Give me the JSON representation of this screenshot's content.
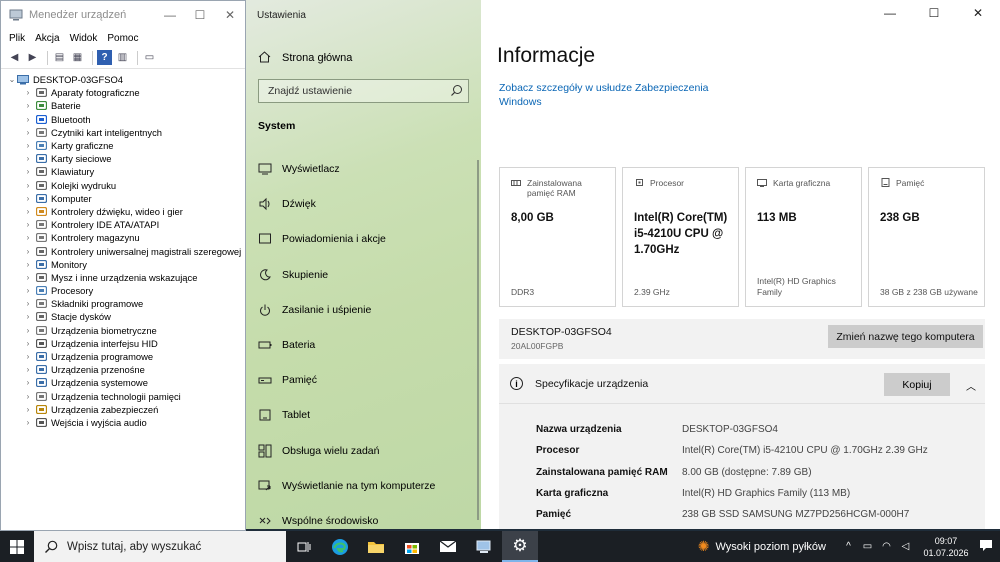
{
  "devmgr": {
    "title": "Menedżer urządzeń",
    "menu": [
      "Plik",
      "Akcja",
      "Widok",
      "Pomoc"
    ],
    "root": "DESKTOP-03GFSO4",
    "nodes": [
      "Aparaty fotograficzne",
      "Baterie",
      "Bluetooth",
      "Czytniki kart inteligentnych",
      "Karty graficzne",
      "Karty sieciowe",
      "Klawiatury",
      "Kolejki wydruku",
      "Komputer",
      "Kontrolery dźwięku, wideo i gier",
      "Kontrolery IDE ATA/ATAPI",
      "Kontrolery magazynu",
      "Kontrolery uniwersalnej magistrali szeregowej",
      "Monitory",
      "Mysz i inne urządzenia wskazujące",
      "Procesory",
      "Składniki programowe",
      "Stacje dysków",
      "Urządzenia biometryczne",
      "Urządzenia interfejsu HID",
      "Urządzenia programowe",
      "Urządzenia przenośne",
      "Urządzenia systemowe",
      "Urządzenia technologii pamięci",
      "Urządzenia zabezpieczeń",
      "Wejścia i wyjścia audio"
    ]
  },
  "settings": {
    "app_title": "Ustawienia",
    "home": "Strona główna",
    "search_placeholder": "Znajdź ustawienie",
    "section": "System",
    "nav": [
      {
        "label": "Wyświetlacz",
        "icon": "display-icon"
      },
      {
        "label": "Dźwięk",
        "icon": "speaker-icon"
      },
      {
        "label": "Powiadomienia i akcje",
        "icon": "notification-icon"
      },
      {
        "label": "Skupienie",
        "icon": "moon-icon"
      },
      {
        "label": "Zasilanie i uśpienie",
        "icon": "power-icon"
      },
      {
        "label": "Bateria",
        "icon": "battery-icon"
      },
      {
        "label": "Pamięć",
        "icon": "storage-icon"
      },
      {
        "label": "Tablet",
        "icon": "tablet-icon"
      },
      {
        "label": "Obsługa wielu zadań",
        "icon": "multitask-icon"
      },
      {
        "label": "Wyświetlanie na tym komputerze",
        "icon": "project-icon"
      },
      {
        "label": "Wspólne środowisko",
        "icon": "shared-icon"
      }
    ],
    "page_title": "Informacje",
    "security_link": "Zobacz szczegóły w usłudze Zabezpieczenia Windows",
    "cards": [
      {
        "label": "Zainstalowana pamięć RAM",
        "value": "8,00 GB",
        "sub": "DDR3",
        "icon": "ram-icon"
      },
      {
        "label": "Procesor",
        "value": "Intel(R) Core(TM) i5-4210U CPU @ 1.70GHz",
        "sub": "2.39 GHz",
        "icon": "cpu-icon"
      },
      {
        "label": "Karta graficzna",
        "value": "113 MB",
        "sub": "Intel(R) HD Graphics Family",
        "icon": "gpu-icon"
      },
      {
        "label": "Pamięć",
        "value": "238 GB",
        "sub": "38 GB z 238 GB używane",
        "icon": "disk-icon"
      }
    ],
    "hostname": "DESKTOP-03GFSO4",
    "model": "20AL00FGPB",
    "rename_button": "Zmień nazwę tego komputera",
    "spec_title": "Specyfikacje urządzenia",
    "copy_button": "Kopiuj",
    "specs": [
      {
        "key": "Nazwa urządzenia",
        "value": "DESKTOP-03GFSO4"
      },
      {
        "key": "Procesor",
        "value": "Intel(R) Core(TM) i5-4210U CPU @ 1.70GHz   2.39 GHz"
      },
      {
        "key": "Zainstalowana pamięć RAM",
        "value": "8.00 GB (dostępne: 7.89 GB)"
      },
      {
        "key": "Karta graficzna",
        "value": "Intel(R) HD Graphics Family (113 MB)"
      },
      {
        "key": "Pamięć",
        "value": "238 GB SSD SAMSUNG MZ7PD256HCGM-000H7"
      }
    ]
  },
  "taskbar": {
    "search_placeholder": "Wpisz tutaj, aby wyszukać",
    "weather": "Wysoki poziom pyłków",
    "time": "09:07",
    "date": "01.07.2026"
  }
}
